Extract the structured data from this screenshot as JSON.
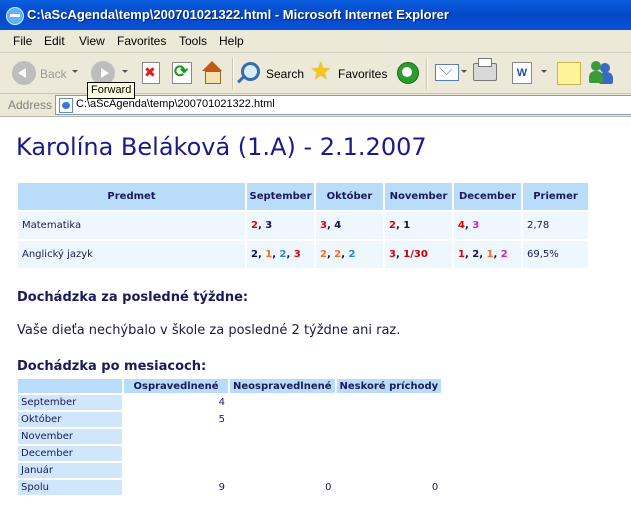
{
  "window": {
    "title": "C:\\aScAgenda\\temp\\200701021322.html - Microsoft Internet Explorer"
  },
  "menu": [
    "File",
    "Edit",
    "View",
    "Favorites",
    "Tools",
    "Help"
  ],
  "toolbar": {
    "back": "Back",
    "search": "Search",
    "favorites": "Favorites",
    "tooltip": "Forward"
  },
  "address": {
    "label": "Address",
    "url": "C:\\aScAgenda\\temp\\200701021322.html"
  },
  "page": {
    "title": "Karolína Beláková (1.A) - 2.1.2007",
    "grades": {
      "headers": [
        "Predmet",
        "September",
        "Október",
        "November",
        "December",
        "Priemer"
      ],
      "rows": [
        {
          "subject": "Matematika",
          "months": [
            [
              {
                "t": "2",
                "c": "r"
              },
              {
                "t": ", ",
                "c": "k"
              },
              {
                "t": "3",
                "c": "k"
              }
            ],
            [
              {
                "t": "3",
                "c": "r"
              },
              {
                "t": ", ",
                "c": "k"
              },
              {
                "t": "4",
                "c": "k"
              }
            ],
            [
              {
                "t": "2",
                "c": "r"
              },
              {
                "t": ", ",
                "c": "k"
              },
              {
                "t": "1",
                "c": "k"
              }
            ],
            [
              {
                "t": "4",
                "c": "r"
              },
              {
                "t": ", ",
                "c": "k"
              },
              {
                "t": "3",
                "c": "m"
              }
            ]
          ],
          "average": "2,78"
        },
        {
          "subject": "Anglický jazyk",
          "months": [
            [
              {
                "t": "2",
                "c": "k"
              },
              {
                "t": ", ",
                "c": "k"
              },
              {
                "t": "1",
                "c": "o"
              },
              {
                "t": ", ",
                "c": "k"
              },
              {
                "t": "2",
                "c": "b"
              },
              {
                "t": ", ",
                "c": "k"
              },
              {
                "t": "3",
                "c": "r"
              }
            ],
            [
              {
                "t": "2",
                "c": "o"
              },
              {
                "t": ", ",
                "c": "k"
              },
              {
                "t": "2",
                "c": "o"
              },
              {
                "t": ", ",
                "c": "k"
              },
              {
                "t": "2",
                "c": "b"
              }
            ],
            [
              {
                "t": "3",
                "c": "r"
              },
              {
                "t": ", ",
                "c": "k"
              },
              {
                "t": "1/30",
                "c": "dr"
              }
            ],
            [
              {
                "t": "1",
                "c": "r"
              },
              {
                "t": ", ",
                "c": "k"
              },
              {
                "t": "2",
                "c": "k"
              },
              {
                "t": ", ",
                "c": "k"
              },
              {
                "t": "1",
                "c": "o"
              },
              {
                "t": ", ",
                "c": "k"
              },
              {
                "t": "2",
                "c": "m"
              }
            ]
          ],
          "average": "69,5%"
        }
      ]
    },
    "attendance_weeks": {
      "heading": "Dochádzka za posledné týždne:",
      "text": "Vaše dieťa nechýbalo v škole za posledné 2 týždne ani raz."
    },
    "attendance_months": {
      "heading": "Dochádzka po mesiacoch:",
      "headers": [
        "",
        "Ospravedlnené",
        "Neospravedlnené",
        "Neskoré príchody"
      ],
      "rows": [
        {
          "label": "September",
          "excused": "4",
          "unexcused": "",
          "late": ""
        },
        {
          "label": "Október",
          "excused": "5",
          "unexcused": "",
          "late": ""
        },
        {
          "label": "November",
          "excused": "",
          "unexcused": "",
          "late": ""
        },
        {
          "label": "December",
          "excused": "",
          "unexcused": "",
          "late": ""
        },
        {
          "label": "Január",
          "excused": "",
          "unexcused": "",
          "late": ""
        },
        {
          "label": "Spolu",
          "excused": "9",
          "unexcused": "0",
          "late": "0"
        }
      ]
    }
  },
  "colors": {
    "r": "#e00000",
    "k": "#101060",
    "o": "#ff6a20",
    "b": "#1a8ad8",
    "m": "#d020d0",
    "dr": "#c00000"
  }
}
